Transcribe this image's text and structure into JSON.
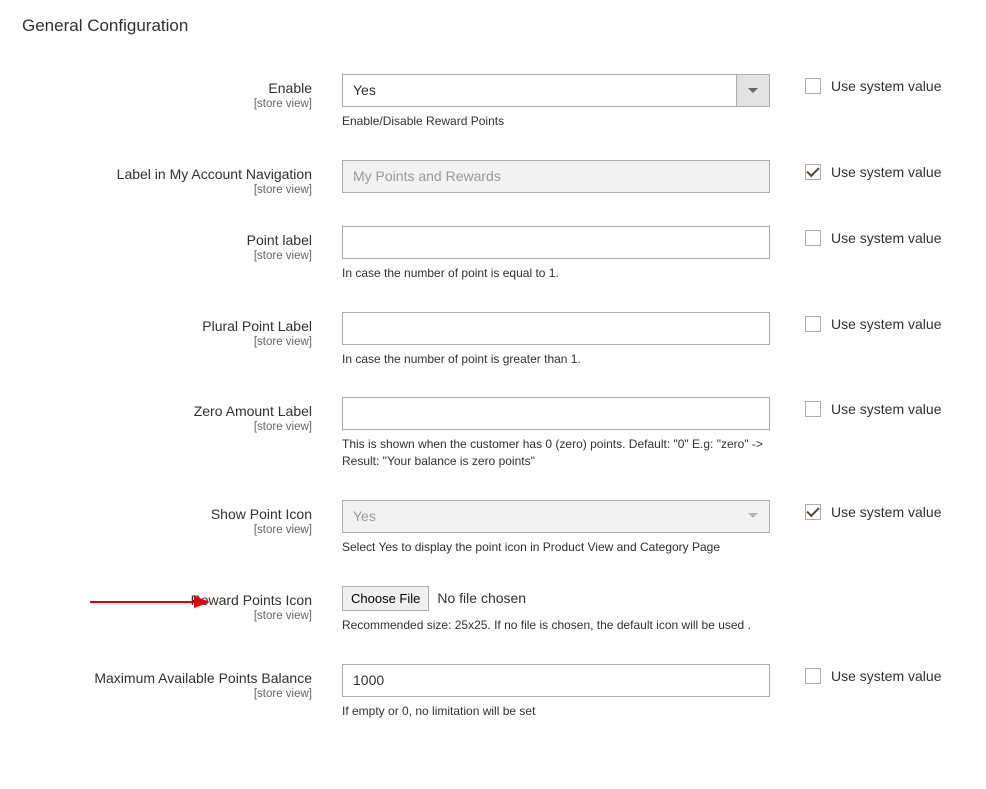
{
  "section_title": "General Configuration",
  "scope_text": "[store view]",
  "use_system_value_label": "Use system value",
  "fields": {
    "enable": {
      "label": "Enable",
      "value": "Yes",
      "note": "Enable/Disable Reward Points",
      "use_system": false
    },
    "account_nav_label": {
      "label": "Label in My Account Navigation",
      "value": "My Points and Rewards",
      "use_system": true
    },
    "point_label": {
      "label": "Point label",
      "value": "",
      "note": "In case the number of point is equal to 1.",
      "use_system": false
    },
    "plural_point_label": {
      "label": "Plural Point Label",
      "value": "",
      "note": "In case the number of point is greater than 1.",
      "use_system": false
    },
    "zero_amount_label": {
      "label": "Zero Amount Label",
      "value": "",
      "note": "This is shown when the customer has 0 (zero) points. Default: \"0\" E.g: \"zero\" -> Result: \"Your balance is zero points\"",
      "use_system": false
    },
    "show_point_icon": {
      "label": "Show Point Icon",
      "value": "Yes",
      "note": "Select Yes to display the point icon in Product View and Category Page",
      "use_system": true
    },
    "reward_points_icon": {
      "label": "Reward Points Icon",
      "choose_btn": "Choose File",
      "no_file_text": "No file chosen",
      "note": "Recommended size: 25x25. If no file is chosen, the default icon will be used ."
    },
    "max_points_balance": {
      "label": "Maximum Available Points Balance",
      "value": "1000",
      "note": "If empty or 0, no limitation will be set",
      "use_system": false
    }
  }
}
